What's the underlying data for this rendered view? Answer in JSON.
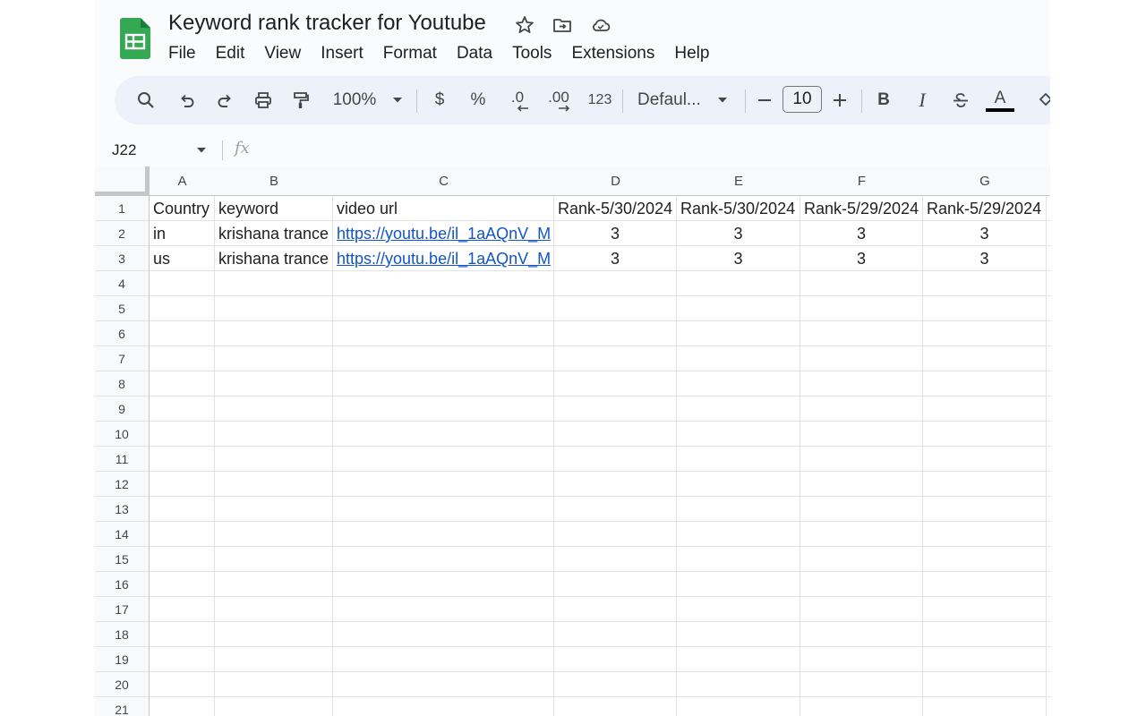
{
  "document": {
    "title": "Keyword rank tracker for Youtube"
  },
  "menu": [
    "File",
    "Edit",
    "View",
    "Insert",
    "Format",
    "Data",
    "Tools",
    "Extensions",
    "Help"
  ],
  "toolbar": {
    "zoom": "100%",
    "currency": "$",
    "percent": "%",
    "decrease_decimal": ".0",
    "increase_decimal": ".00",
    "number_format": "123",
    "font": "Defaul...",
    "font_size": "10",
    "bold": "B",
    "italic": "I",
    "text_color": "A"
  },
  "formula_bar": {
    "cell_ref": "J22",
    "fx": "fx",
    "value": ""
  },
  "sheet": {
    "columns": [
      "A",
      "B",
      "C",
      "D",
      "E",
      "F",
      "G"
    ],
    "rows": [
      "1",
      "2",
      "3",
      "4",
      "5",
      "6",
      "7",
      "8",
      "9",
      "10",
      "11",
      "12",
      "13",
      "14",
      "15",
      "16",
      "17",
      "18",
      "19",
      "20",
      "21"
    ],
    "data": [
      [
        "Country",
        "keyword",
        "video url",
        "Rank-5/30/2024",
        "Rank-5/30/2024",
        "Rank-5/29/2024",
        "Rank-5/29/2024"
      ],
      [
        "in",
        "krishana trance",
        "https://youtu.be/il_1aAQnV_M",
        "3",
        "3",
        "3",
        "3"
      ],
      [
        "us",
        "krishana trance",
        "https://youtu.be/il_1aAQnV_M",
        "3",
        "3",
        "3",
        "3"
      ]
    ]
  },
  "colors": {
    "logo_green": "#34a853",
    "link": "#1155cc",
    "toolbar_bg": "#edf2fa",
    "app_bg": "#f9fbfd"
  }
}
